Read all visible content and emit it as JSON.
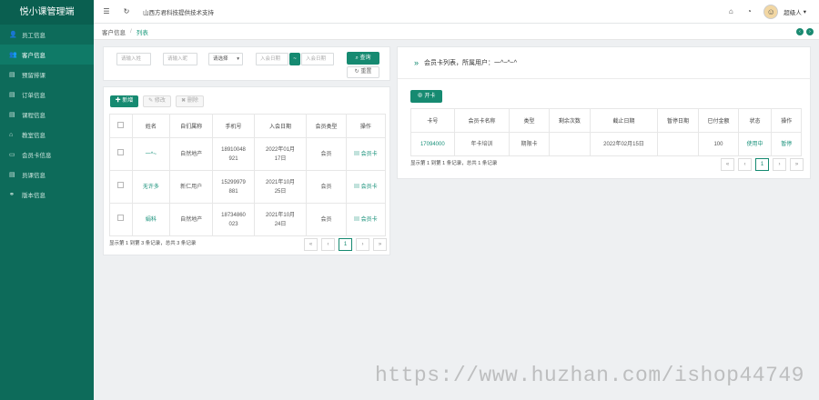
{
  "app": {
    "title": "悦小课管理端"
  },
  "sidebar": {
    "items": [
      {
        "label": "员工信息",
        "icon": "user-icon",
        "glyph": "👤"
      },
      {
        "label": "客户信息",
        "icon": "users-icon",
        "glyph": "👥",
        "active": true
      },
      {
        "label": "预留排课",
        "icon": "calendar-icon",
        "glyph": "▤"
      },
      {
        "label": "订单信息",
        "icon": "order-icon",
        "glyph": "▤"
      },
      {
        "label": "课程信息",
        "icon": "book-icon",
        "glyph": "▤"
      },
      {
        "label": "教室信息",
        "icon": "home-icon",
        "glyph": "⌂"
      },
      {
        "label": "会员卡信息",
        "icon": "card-icon",
        "glyph": "▭"
      },
      {
        "label": "员课信息",
        "icon": "doc-icon",
        "glyph": "▤"
      },
      {
        "label": "版本信息",
        "icon": "link-icon",
        "glyph": "⚭"
      }
    ]
  },
  "topbar": {
    "tagline": "山西方君科技提供技术支持",
    "username": "超级人",
    "menu_glyph": "☰",
    "refresh_glyph": "↻",
    "home_glyph": "⌂",
    "dashboard_glyph": "◔",
    "caret": "▾"
  },
  "breadcrumb": {
    "parent": "客户信息",
    "separator": "/",
    "current": "列表"
  },
  "left_panel": {
    "search": {
      "name_placeholder": "请输入姓",
      "nickname_placeholder": "请输入昵",
      "select_value": "请选择",
      "date_start_placeholder": "入会日期",
      "date_sep": "~",
      "date_end_placeholder": "入会日期",
      "search_label": "查询",
      "reset_label": "重置"
    },
    "toolbar": {
      "add_label": "新增",
      "edit_label": "修改",
      "delete_label": "删除"
    },
    "table": {
      "headers": [
        "姓名",
        "自们属称",
        "手机号",
        "入会日期",
        "会员类型",
        "操作"
      ],
      "rows": [
        {
          "name": "一^~",
          "nick": "自然地产",
          "phone": "18910048\n921",
          "date": "2022年01月\n17日",
          "type": "会员",
          "action": "会员卡"
        },
        {
          "name": "无许多",
          "nick": "新仁用户",
          "phone": "15299979\n881",
          "date": "2021年10月\n25日",
          "type": "会员",
          "action": "会员卡"
        },
        {
          "name": "娟科",
          "nick": "自然地产",
          "phone": "18734860\n023",
          "date": "2021年10月\n24日",
          "type": "会员",
          "action": "会员卡"
        }
      ]
    },
    "pager": {
      "info": "显示第 1 到第 3 条记录，总共 3 条记录",
      "page": "1",
      "prev": "‹",
      "first": "«",
      "next": "›",
      "last": "»"
    }
  },
  "right_panel": {
    "title": "会员卡列表，所属用户：",
    "owner": "一^~^~^",
    "add_label": "开卡",
    "table": {
      "headers": [
        "卡号",
        "会员卡名称",
        "类型",
        "剩余次数",
        "截止日期",
        "暂停日期",
        "已付金额",
        "状态",
        "操作"
      ],
      "rows": [
        {
          "card_no": "17094000",
          "card_name": "年卡培训",
          "type": "期限卡",
          "remaining": "",
          "end_date": "2022年02月15日",
          "pause_date": "",
          "paid": "100",
          "status": "使用中",
          "action": "暂停"
        }
      ]
    },
    "pager": {
      "info": "显示第 1 到第 1 条记录，总共 1 条记录",
      "page": "1",
      "prev": "‹",
      "first": "«",
      "next": "›",
      "last": "»"
    }
  },
  "watermark": "https://www.huzhan.com/ishop44749",
  "colors": {
    "sidebar": "#0d6b5a",
    "accent": "#168a71"
  }
}
